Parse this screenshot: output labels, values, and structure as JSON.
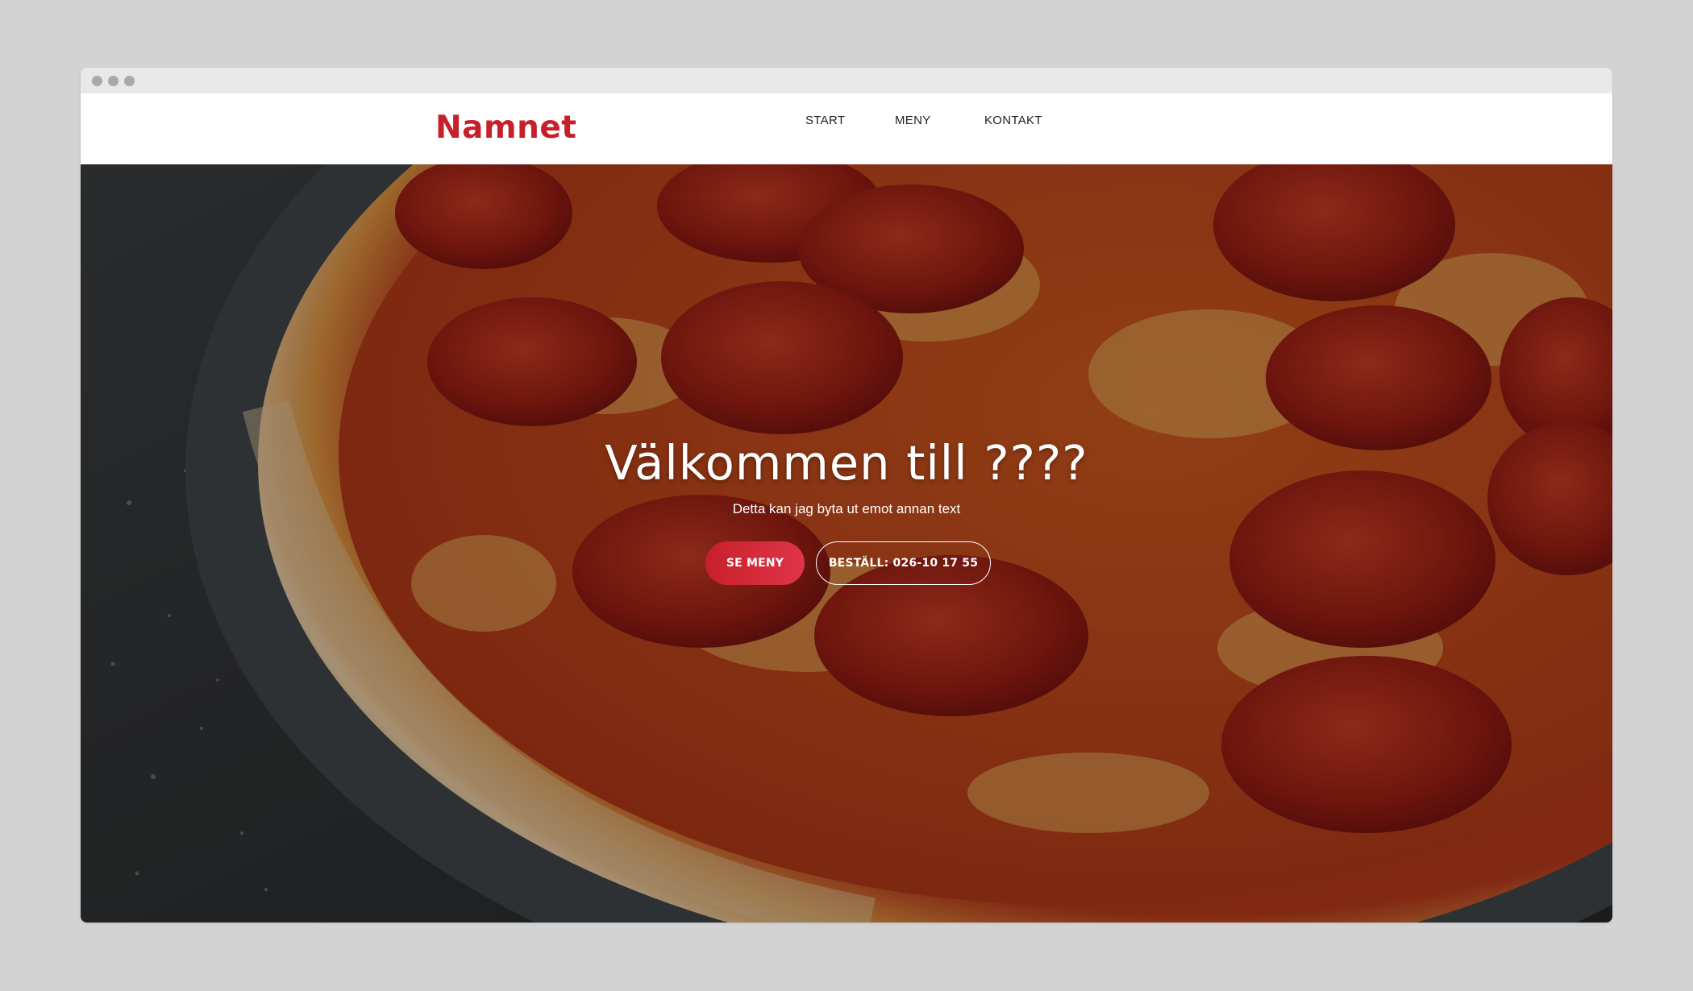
{
  "brand": {
    "name": "Namnet",
    "color": "#c8202a"
  },
  "nav": {
    "items": [
      {
        "label": "START"
      },
      {
        "label": "MENY"
      },
      {
        "label": "KONTAKT"
      }
    ]
  },
  "hero": {
    "title": "Välkommen till ????",
    "subtitle": "Detta kan jag byta ut emot annan text",
    "primary_button": "SE MENY",
    "secondary_button": "BESTÄLL: 026-10 17 55",
    "image_icon": "pepperoni-pizza-photo"
  }
}
